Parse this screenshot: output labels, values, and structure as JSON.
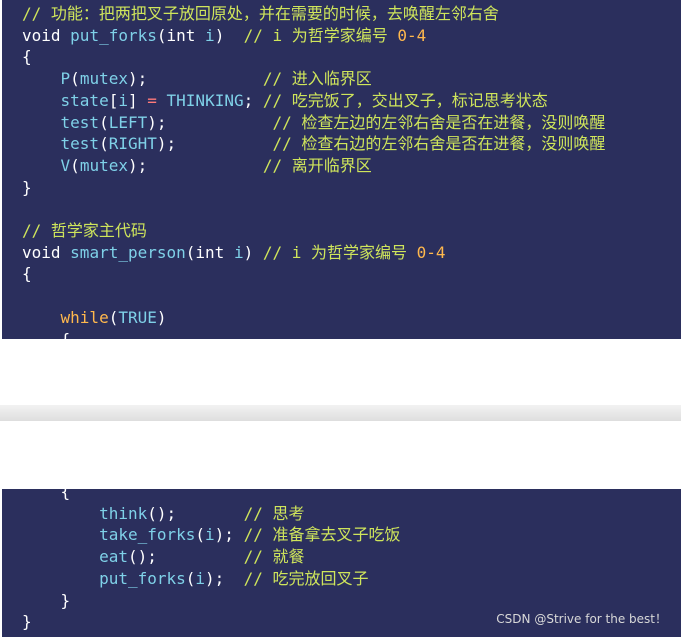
{
  "top": {
    "lines": [
      [
        {
          "t": "cmt",
          "v": "// 功能：把两把叉子放回原处，并在需要的时候，去唤醒左邻右舍"
        }
      ],
      [
        {
          "t": "kw",
          "v": "void "
        },
        {
          "t": "fn",
          "v": "put_forks"
        },
        {
          "t": "kw",
          "v": "(int "
        },
        {
          "t": "param",
          "v": "i"
        },
        {
          "t": "kw",
          "v": ")  "
        },
        {
          "t": "cmt",
          "v": "// i 为哲学家编号 "
        },
        {
          "t": "num",
          "v": "0-4"
        }
      ],
      [
        {
          "t": "kw",
          "v": "{"
        }
      ],
      [
        {
          "t": "kw",
          "v": "    "
        },
        {
          "t": "fn",
          "v": "P"
        },
        {
          "t": "kw",
          "v": "("
        },
        {
          "t": "param",
          "v": "mutex"
        },
        {
          "t": "kw",
          "v": ");            "
        },
        {
          "t": "cmt",
          "v": "// 进入临界区"
        }
      ],
      [
        {
          "t": "kw",
          "v": "    "
        },
        {
          "t": "fn",
          "v": "state"
        },
        {
          "t": "kw",
          "v": "["
        },
        {
          "t": "param",
          "v": "i"
        },
        {
          "t": "kw",
          "v": "] "
        },
        {
          "t": "op",
          "v": "="
        },
        {
          "t": "kw",
          "v": " "
        },
        {
          "t": "param",
          "v": "THINKING"
        },
        {
          "t": "kw",
          "v": "; "
        },
        {
          "t": "cmt",
          "v": "// 吃完饭了，交出叉子，标记思考状态"
        }
      ],
      [
        {
          "t": "kw",
          "v": "    "
        },
        {
          "t": "fn",
          "v": "test"
        },
        {
          "t": "kw",
          "v": "("
        },
        {
          "t": "param",
          "v": "LEFT"
        },
        {
          "t": "kw",
          "v": ");           "
        },
        {
          "t": "cmt",
          "v": "// 检查左边的左邻右舍是否在进餐，没则唤醒"
        }
      ],
      [
        {
          "t": "kw",
          "v": "    "
        },
        {
          "t": "fn",
          "v": "test"
        },
        {
          "t": "kw",
          "v": "("
        },
        {
          "t": "param",
          "v": "RIGHT"
        },
        {
          "t": "kw",
          "v": ");          "
        },
        {
          "t": "cmt",
          "v": "// 检查右边的左邻右舍是否在进餐，没则唤醒"
        }
      ],
      [
        {
          "t": "kw",
          "v": "    "
        },
        {
          "t": "fn",
          "v": "V"
        },
        {
          "t": "kw",
          "v": "("
        },
        {
          "t": "param",
          "v": "mutex"
        },
        {
          "t": "kw",
          "v": ");            "
        },
        {
          "t": "cmt",
          "v": "// 离开临界区"
        }
      ],
      [
        {
          "t": "kw",
          "v": "}"
        }
      ],
      [
        {
          "t": "kw",
          "v": ""
        }
      ],
      [
        {
          "t": "cmt",
          "v": "// 哲学家主代码"
        }
      ],
      [
        {
          "t": "kw",
          "v": "void "
        },
        {
          "t": "fn",
          "v": "smart_person"
        },
        {
          "t": "kw",
          "v": "(int "
        },
        {
          "t": "param",
          "v": "i"
        },
        {
          "t": "kw",
          "v": ") "
        },
        {
          "t": "cmt",
          "v": "// i 为哲学家编号 "
        },
        {
          "t": "num",
          "v": "0-4"
        }
      ],
      [
        {
          "t": "kw",
          "v": "{"
        }
      ],
      [
        {
          "t": "kw",
          "v": ""
        }
      ],
      [
        {
          "t": "kw",
          "v": "    "
        },
        {
          "t": "while",
          "v": "while"
        },
        {
          "t": "kw",
          "v": "("
        },
        {
          "t": "param",
          "v": "TRUE"
        },
        {
          "t": "kw",
          "v": ")"
        }
      ],
      [
        {
          "t": "kw",
          "v": "    {"
        }
      ]
    ]
  },
  "bottom": {
    "lines": [
      [
        {
          "t": "kw",
          "v": "    {"
        }
      ],
      [
        {
          "t": "kw",
          "v": "        "
        },
        {
          "t": "fn",
          "v": "think"
        },
        {
          "t": "kw",
          "v": "();       "
        },
        {
          "t": "cmt",
          "v": "// 思考"
        }
      ],
      [
        {
          "t": "kw",
          "v": "        "
        },
        {
          "t": "fn",
          "v": "take_forks"
        },
        {
          "t": "kw",
          "v": "("
        },
        {
          "t": "param",
          "v": "i"
        },
        {
          "t": "kw",
          "v": "); "
        },
        {
          "t": "cmt",
          "v": "// 准备拿去叉子吃饭"
        }
      ],
      [
        {
          "t": "kw",
          "v": "        "
        },
        {
          "t": "fn",
          "v": "eat"
        },
        {
          "t": "kw",
          "v": "();         "
        },
        {
          "t": "cmt",
          "v": "// 就餐"
        }
      ],
      [
        {
          "t": "kw",
          "v": "        "
        },
        {
          "t": "fn",
          "v": "put_forks"
        },
        {
          "t": "kw",
          "v": "("
        },
        {
          "t": "param",
          "v": "i"
        },
        {
          "t": "kw",
          "v": ");  "
        },
        {
          "t": "cmt",
          "v": "// 吃完放回叉子"
        }
      ],
      [
        {
          "t": "kw",
          "v": "    }"
        }
      ],
      [
        {
          "t": "kw",
          "v": "}"
        }
      ]
    ]
  },
  "watermark": "CSDN @Strive for the best！"
}
